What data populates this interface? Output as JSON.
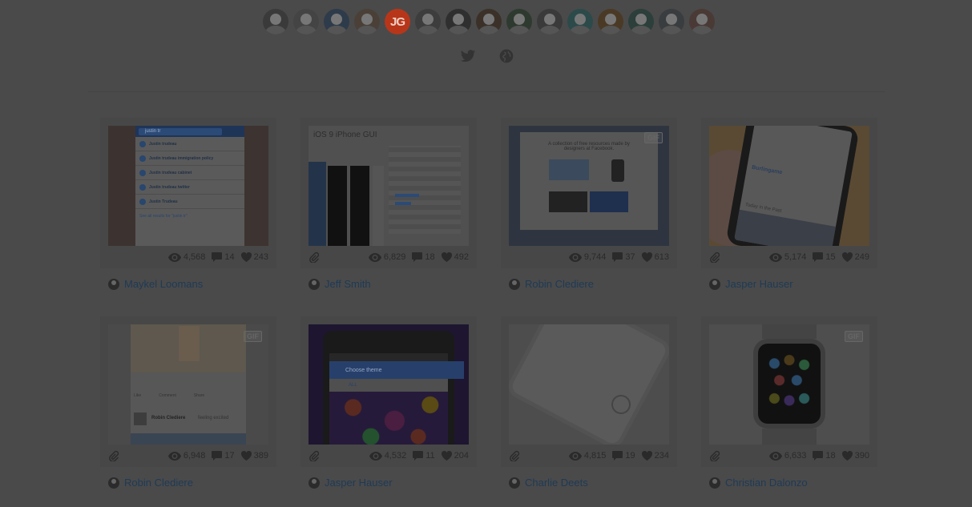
{
  "members": [
    {
      "alt": "member-1",
      "initials": ""
    },
    {
      "alt": "member-2",
      "initials": ""
    },
    {
      "alt": "member-3",
      "initials": ""
    },
    {
      "alt": "member-4",
      "initials": ""
    },
    {
      "alt": "member-5",
      "initials": "JG"
    },
    {
      "alt": "member-6",
      "initials": ""
    },
    {
      "alt": "member-7",
      "initials": ""
    },
    {
      "alt": "member-8",
      "initials": ""
    },
    {
      "alt": "member-9",
      "initials": ""
    },
    {
      "alt": "member-10",
      "initials": ""
    },
    {
      "alt": "member-11",
      "initials": ""
    },
    {
      "alt": "member-12",
      "initials": ""
    },
    {
      "alt": "member-13",
      "initials": ""
    },
    {
      "alt": "member-14",
      "initials": ""
    },
    {
      "alt": "member-15",
      "initials": ""
    }
  ],
  "social": [
    "twitter-icon",
    "globe-icon"
  ],
  "shots": [
    {
      "author": "Maykel Loomans",
      "views": "4,568",
      "comments": "14",
      "likes": "243",
      "gif": false,
      "attachment": false,
      "thumb": {
        "title": "",
        "search": "justin tr",
        "lines": [
          "Justin trudeau",
          "Justin trudeau immigration policy",
          "Justin trudeau cabinet",
          "Justin trudeau twitter",
          "Justin Trudeau"
        ],
        "footer": "See all results for \"justin tr\""
      }
    },
    {
      "author": "Jeff Smith",
      "views": "6,829",
      "comments": "18",
      "likes": "492",
      "gif": false,
      "attachment": true,
      "thumb": {
        "title": "iOS 9 iPhone GUI"
      }
    },
    {
      "author": "Robin Clediere",
      "views": "9,744",
      "comments": "37",
      "likes": "613",
      "gif": true,
      "attachment": false,
      "thumb": {
        "title": "A collection of free resources made by designers at Facebook."
      }
    },
    {
      "author": "Jasper Hauser",
      "views": "5,174",
      "comments": "15",
      "likes": "249",
      "gif": false,
      "attachment": true,
      "thumb": {
        "title": "Burlingame",
        "subtitle": "Today in the Past"
      }
    },
    {
      "author": "Robin Clediere",
      "views": "6,948",
      "comments": "17",
      "likes": "389",
      "gif": true,
      "attachment": true,
      "thumb": {
        "title": "Robin Clediere",
        "subtitle": "feeling excited",
        "actions": [
          "Like",
          "Comment",
          "Share"
        ]
      }
    },
    {
      "author": "Jasper Hauser",
      "views": "4,532",
      "comments": "11",
      "likes": "204",
      "gif": false,
      "attachment": true,
      "thumb": {
        "title": "Choose theme",
        "tab": "ALL"
      }
    },
    {
      "author": "Charlie Deets",
      "views": "4,815",
      "comments": "19",
      "likes": "234",
      "gif": false,
      "attachment": true,
      "thumb": {
        "title": ""
      }
    },
    {
      "author": "Christian Dalonzo",
      "views": "6,633",
      "comments": "18",
      "likes": "390",
      "gif": true,
      "attachment": true,
      "thumb": {
        "title": ""
      }
    }
  ],
  "colors": {
    "page_bg": "#4a4a4a",
    "link": "#1e3a56",
    "stat": "#2a2a2a"
  }
}
